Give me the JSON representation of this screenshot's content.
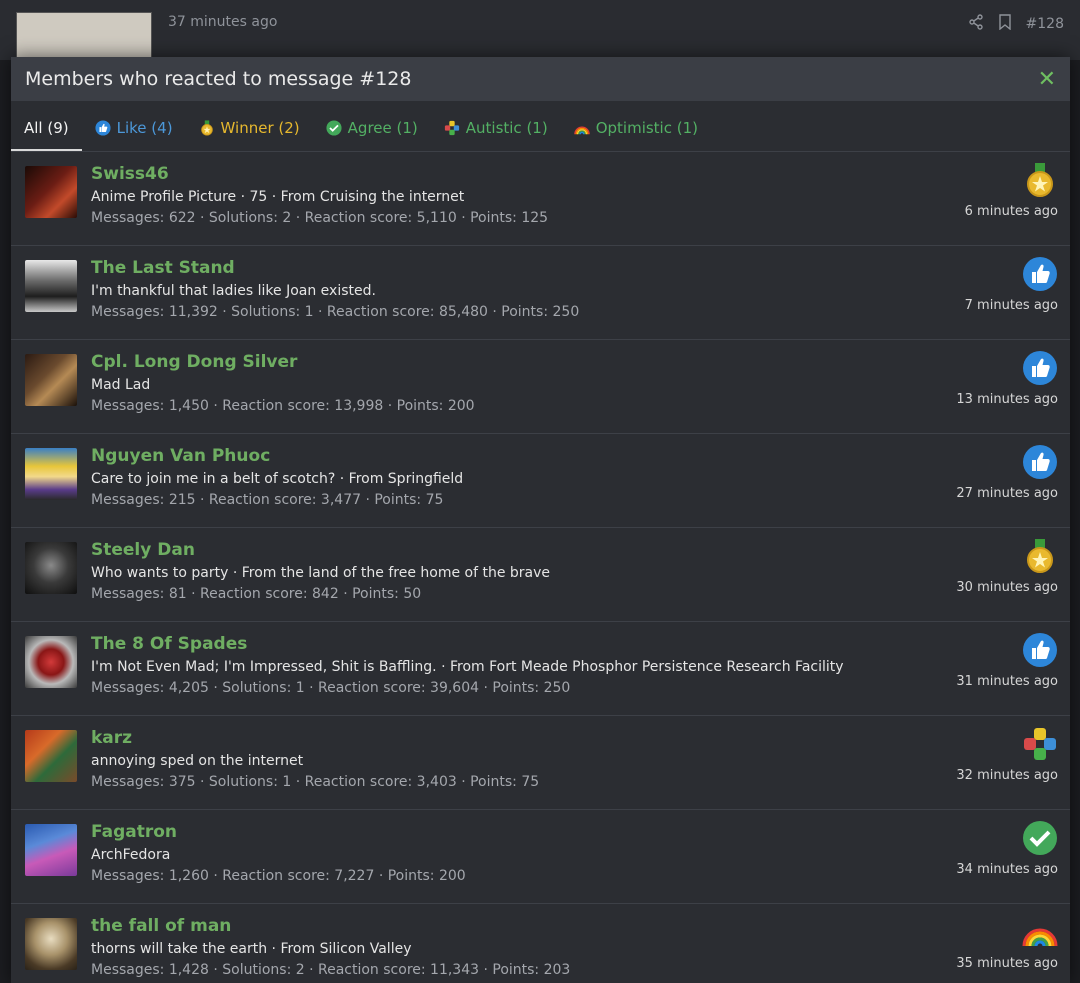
{
  "background": {
    "time": "37 minutes ago",
    "post_number": "#128"
  },
  "modal": {
    "title": "Members who reacted to message #128",
    "close": "✕"
  },
  "tabs": [
    {
      "label": "All (9)",
      "icon": "none",
      "color": "#f3f3f3"
    },
    {
      "label": "Like (4)",
      "icon": "like-icon",
      "color": "#4c98d9"
    },
    {
      "label": "Winner (2)",
      "icon": "winner-icon",
      "color": "#e6b82e"
    },
    {
      "label": "Agree (1)",
      "icon": "agree-icon",
      "color": "#53b064"
    },
    {
      "label": "Autistic (1)",
      "icon": "autistic-icon",
      "color": "#53b064"
    },
    {
      "label": "Optimistic (1)",
      "icon": "optimistic-icon",
      "color": "#53b064"
    }
  ],
  "users": [
    {
      "name": "Swiss46",
      "title": "Anime Profile Picture · 75 · From Cruising the internet",
      "stats": "Messages: 622 · Solutions: 2 · Reaction score: 5,110 · Points: 125",
      "reaction": "winner-icon",
      "ago": "6 minutes ago"
    },
    {
      "name": "The Last Stand",
      "title": "I'm thankful that ladies like Joan existed.",
      "stats": "Messages: 11,392 · Solutions: 1 · Reaction score: 85,480 · Points: 250",
      "reaction": "like-icon",
      "ago": "7 minutes ago"
    },
    {
      "name": "Cpl. Long Dong Silver",
      "title": "Mad Lad",
      "stats": "Messages: 1,450 · Reaction score: 13,998 · Points: 200",
      "reaction": "like-icon",
      "ago": "13 minutes ago"
    },
    {
      "name": "Nguyen Van Phuoc",
      "title": "Care to join me in a belt of scotch? · From Springfield",
      "stats": "Messages: 215 · Reaction score: 3,477 · Points: 75",
      "reaction": "like-icon",
      "ago": "27 minutes ago"
    },
    {
      "name": "Steely Dan",
      "title": "Who wants to party · From the land of the free home of the brave",
      "stats": "Messages: 81 · Reaction score: 842 · Points: 50",
      "reaction": "winner-icon",
      "ago": "30 minutes ago"
    },
    {
      "name": "The 8 Of Spades",
      "title": "I'm Not Even Mad; I'm Impressed, Shit is Baffling. · From Fort Meade Phosphor Persistence Research Facility",
      "stats": "Messages: 4,205 · Solutions: 1 · Reaction score: 39,604 · Points: 250",
      "reaction": "like-icon",
      "ago": "31 minutes ago"
    },
    {
      "name": "karz",
      "title": "annoying sped on the internet",
      "stats": "Messages: 375 · Solutions: 1 · Reaction score: 3,403 · Points: 75",
      "reaction": "autistic-icon",
      "ago": "32 minutes ago"
    },
    {
      "name": "Fagatron",
      "title": "ArchFedora",
      "stats": "Messages: 1,260 · Reaction score: 7,227 · Points: 200",
      "reaction": "agree-icon",
      "ago": "34 minutes ago"
    },
    {
      "name": "the fall of man",
      "title": "thorns will take the earth · From Silicon Valley",
      "stats": "Messages: 1,428 · Solutions: 2 · Reaction score: 11,343 · Points: 203",
      "reaction": "optimistic-icon",
      "ago": "35 minutes ago"
    }
  ]
}
